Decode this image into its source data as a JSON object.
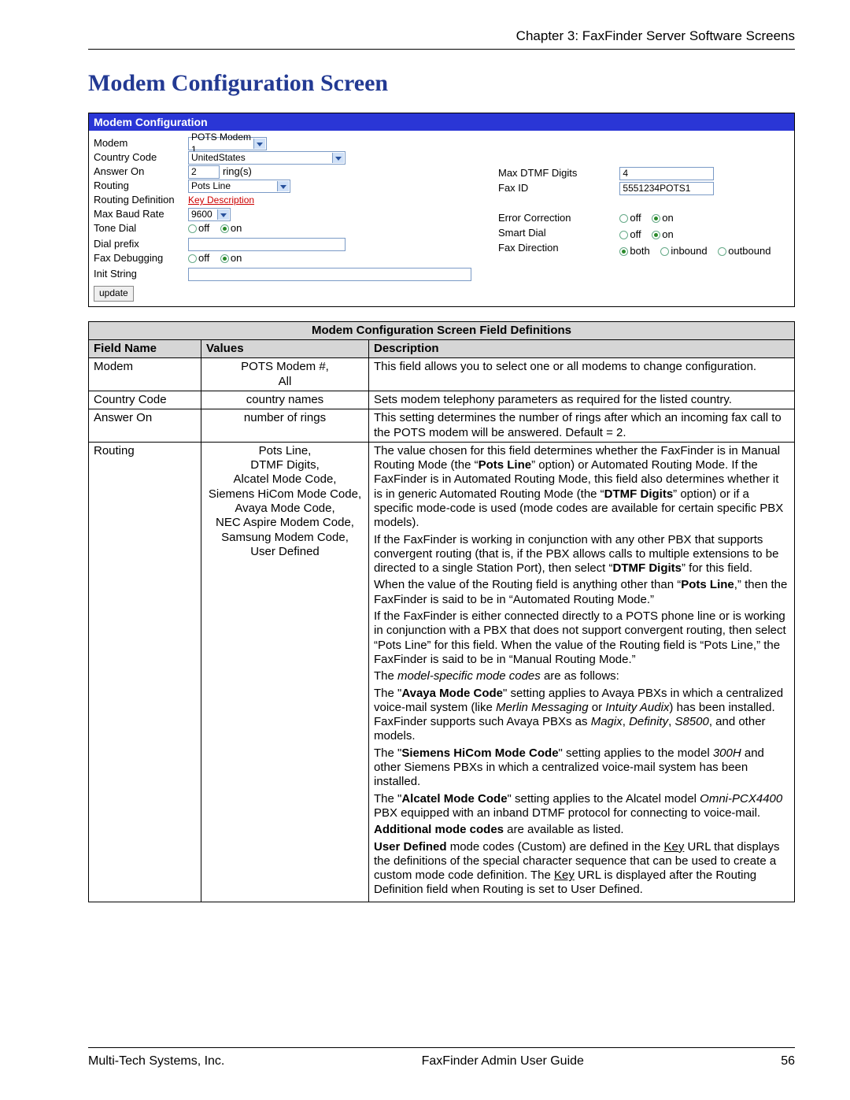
{
  "chapter_header": "Chapter 3: FaxFinder Server Software Screens",
  "section_title": "Modem Configuration Screen",
  "panel_title": "Modem Configuration",
  "form": {
    "modem": {
      "label": "Modem",
      "value": "POTS Modem 1"
    },
    "country_code": {
      "label": "Country Code",
      "value": "UnitedStates"
    },
    "answer_on": {
      "label": "Answer On",
      "value": "2",
      "unit": "ring(s)"
    },
    "routing": {
      "label": "Routing",
      "value": "Pots Line"
    },
    "routing_definition": {
      "label": "Routing Definition",
      "link": "Key Description"
    },
    "max_baud_rate": {
      "label": "Max Baud Rate",
      "value": "9600"
    },
    "tone_dial": {
      "label": "Tone Dial",
      "off": "off",
      "on": "on",
      "selected": "on"
    },
    "dial_prefix": {
      "label": "Dial prefix",
      "value": ""
    },
    "fax_debugging": {
      "label": "Fax Debugging",
      "off": "off",
      "on": "on",
      "selected": "on"
    },
    "init_string": {
      "label": "Init String",
      "value": ""
    },
    "update": "update",
    "max_dtmf_digits": {
      "label": "Max DTMF Digits",
      "value": "4"
    },
    "fax_id": {
      "label": "Fax ID",
      "value": "5551234POTS1"
    },
    "error_correction": {
      "label": "Error Correction",
      "off": "off",
      "on": "on",
      "selected": "on"
    },
    "smart_dial": {
      "label": "Smart Dial",
      "off": "off",
      "on": "on",
      "selected": "on"
    },
    "fax_direction": {
      "label": "Fax Direction",
      "both": "both",
      "inbound": "inbound",
      "outbound": "outbound",
      "selected": "both"
    }
  },
  "table": {
    "title": "Modem Configuration Screen Field Definitions",
    "headers": {
      "field": "Field Name",
      "values": "Values",
      "desc": "Description"
    },
    "rows": {
      "modem": {
        "field": "Modem",
        "values": "POTS Modem #,\nAll",
        "desc": "This field allows you to select one or all modems to change configuration."
      },
      "country_code": {
        "field": "Country Code",
        "values": "country names",
        "desc": "Sets modem telephony parameters as required for the listed country."
      },
      "answer_on": {
        "field": "Answer On",
        "values": "number of rings",
        "desc": "This setting determines the number of rings after which an incoming fax call to the POTS modem will be answered. Default = 2."
      },
      "routing": {
        "field": "Routing",
        "values": "Pots Line,\nDTMF Digits,\nAlcatel Mode Code,\nSiemens HiCom Mode Code,\nAvaya Mode Code,\nNEC Aspire Modem Code,\nSamsung Modem Code,\nUser Defined"
      }
    }
  },
  "routing_desc": {
    "p1a": "The value chosen for this field determines whether the FaxFinder is in Manual Routing Mode (the “",
    "p1b": "Pots Line",
    "p1c": "” option) or Automated Routing Mode. If the FaxFinder is in Automated Routing Mode, this field also determines whether it is in generic Automated Routing Mode (the “",
    "p1d": "DTMF Digits",
    "p1e": "” option) or if a specific mode-code is used (mode codes are available for certain specific PBX models).",
    "p2a": "If the FaxFinder is working in conjunction with any other PBX that supports convergent routing (that is, if the PBX allows calls to multiple extensions to be directed to a single Station Port), then select “",
    "p2b": "DTMF Digits",
    "p2c": "” for this field.",
    "p3a": "When the value of the Routing field is anything other than “",
    "p3b": "Pots Line",
    "p3c": ",” then the FaxFinder is said to be in “Automated Routing Mode.”",
    "p4": "If the FaxFinder is either connected directly to a POTS phone line or is working in conjunction with a PBX that does not support convergent routing, then select “Pots Line” for this field. When the value of the Routing field is “Pots Line,” the FaxFinder is said to be in “Manual Routing Mode.”",
    "p5a": "The ",
    "p5b": "model-specific mode codes",
    "p5c": " are as follows:",
    "p6a": "The \"",
    "p6b": "Avaya Mode Code",
    "p6c": "\" setting applies to Avaya PBXs in which a centralized voice-mail system (like ",
    "p6d": "Merlin Messaging",
    "p6e": " or ",
    "p6f": "Intuity Audix",
    "p6g": ") has been installed. FaxFinder supports such Avaya PBXs as ",
    "p6h": "Magix",
    "p6i": ", ",
    "p6j": "Definity",
    "p6k": ", ",
    "p6l": "S8500",
    "p6m": ", and other models.",
    "p7a": "The \"",
    "p7b": "Siemens HiCom Mode Code",
    "p7c": "\" setting applies to the model ",
    "p7d": "300H",
    "p7e": " and other Siemens PBXs in which a centralized voice-mail system has been installed.",
    "p8a": "The \"",
    "p8b": "Alcatel Mode Code",
    "p8c": "\" setting applies to the Alcatel model ",
    "p8d": "Omni-PCX4400",
    "p8e": " PBX equipped with an inband DTMF protocol for connecting to voice-mail.",
    "p9a": "Additional mode codes",
    "p9b": " are available as listed.",
    "p10a": "User Defined",
    "p10b": " mode codes (Custom) are defined in the ",
    "p10c": "Key",
    "p10d": " URL that displays the definitions of the special character sequence that can be used to create a custom mode code definition. The ",
    "p10e": "Key",
    "p10f": " URL is displayed after the Routing Definition field when Routing is set to User Defined."
  },
  "footer": {
    "left": "Multi-Tech Systems, Inc.",
    "center": "FaxFinder Admin User Guide",
    "right": "56"
  }
}
